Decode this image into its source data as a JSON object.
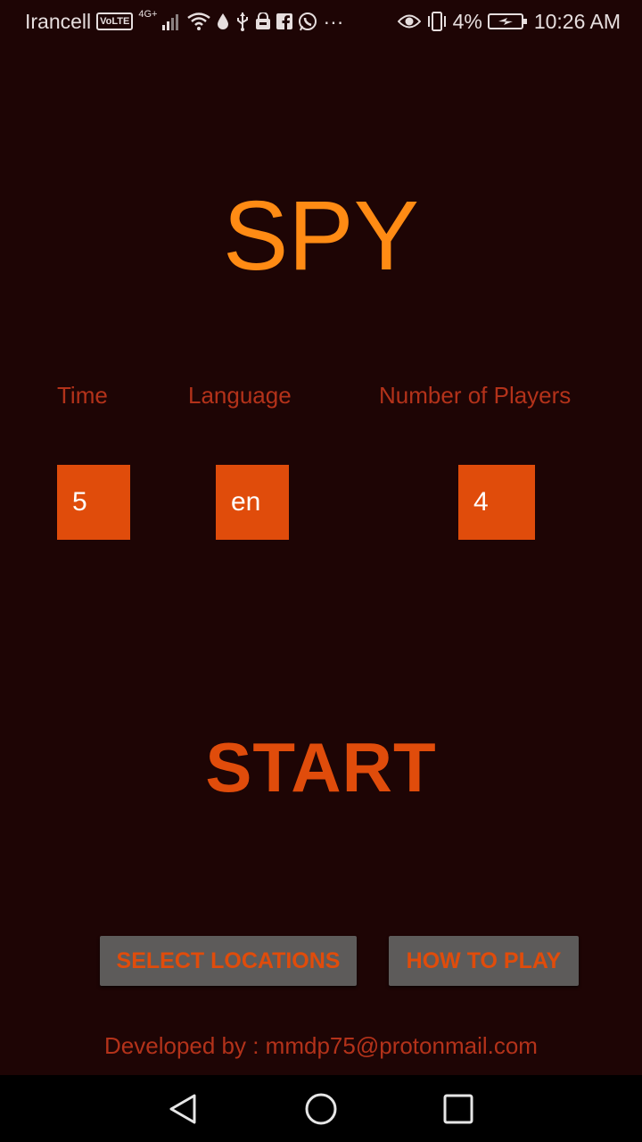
{
  "status_bar": {
    "carrier": "Irancell",
    "volte": "VoLTE",
    "network": "4G+",
    "battery": "4%",
    "time": "10:26 AM",
    "more": "···"
  },
  "app": {
    "title": "SPY",
    "settings": {
      "time": {
        "label": "Time",
        "value": "5"
      },
      "language": {
        "label": "Language",
        "value": "en"
      },
      "players": {
        "label": "Number of Players",
        "value": "4"
      }
    },
    "start_label": "START",
    "select_locations_label": "SELECT LOCATIONS",
    "how_to_play_label": "HOW TO PLAY",
    "footer": "Developed by : mmdp75@protonmail.com"
  },
  "colors": {
    "background": "#1e0505",
    "title": "#ff8b14",
    "accent": "#e04c0b",
    "label": "#b3321a",
    "button_bg": "#5d5b5a"
  }
}
